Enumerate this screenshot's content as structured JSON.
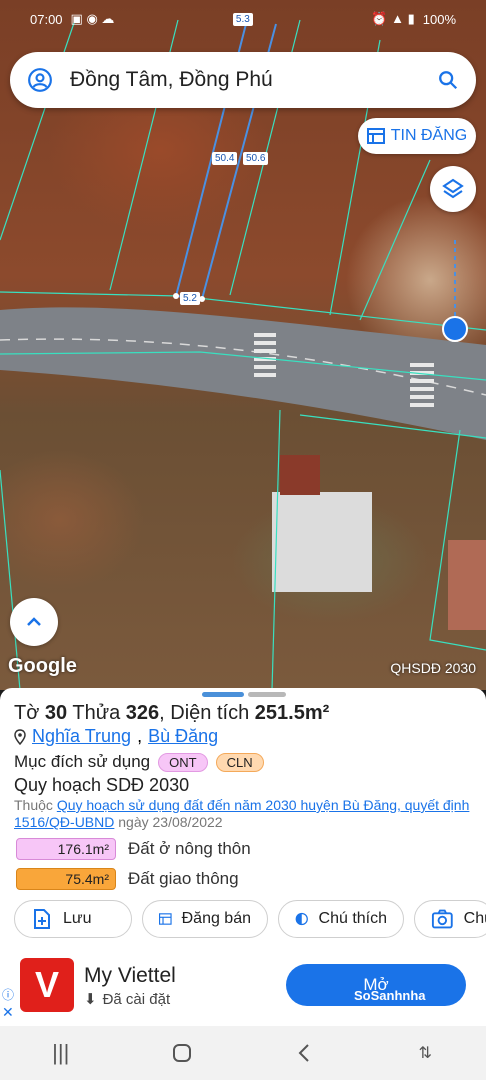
{
  "status_bar": {
    "left_text": "07:00",
    "right_text": "100%",
    "indicator": "5.3"
  },
  "search": {
    "title": "Đồng Tâm, Đồng Phú",
    "user_icon": "account-circle-icon",
    "search_icon": "search-icon"
  },
  "map": {
    "tin_dang_label": "TIN ĐĂNG",
    "attribution": "Google",
    "layer_label": "QHSDĐ 2030",
    "dimensions": [
      "50.4",
      "50.6",
      "5.2"
    ]
  },
  "parcel": {
    "to_label": "Tờ",
    "to_value": "30",
    "thua_label": "Thửa",
    "thua_value": "326",
    "dien_tich_label": ", Diện tích",
    "dien_tich_value": "251.5m²",
    "commune": "Nghĩa Trung",
    "separator": ",",
    "district": "Bù Đăng",
    "purpose_label": "Mục đích sử dụng",
    "purpose_tags": [
      "ONT",
      "CLN"
    ],
    "plan_title": "Quy hoạch SDĐ 2030",
    "plan_prefix": "Thuộc",
    "plan_link": "Quy hoạch sử dụng đất đến năm 2030 huyện Bù Đăng, quyết định 1516/QĐ-UBND",
    "plan_date": "ngày 23/08/2022",
    "areas": [
      {
        "value": "176.1m²",
        "label": "Đất ở nông thôn",
        "color": "#f7c6f7"
      },
      {
        "value": "75.4m²",
        "label": "Đất giao thông",
        "color": "#f9a63a"
      }
    ]
  },
  "actions": {
    "save": "Lưu",
    "post": "Đăng bán",
    "legend": "Chú thích",
    "capture": "Chụ"
  },
  "ad": {
    "app_name": "My Viettel",
    "status": "Đã cài đặt",
    "button": "Mở",
    "watermark": "SoSanhnha"
  },
  "colors": {
    "accent": "#1a73e8",
    "parcel_line": "#4a90e2",
    "boundary_line": "#39e0c0"
  }
}
